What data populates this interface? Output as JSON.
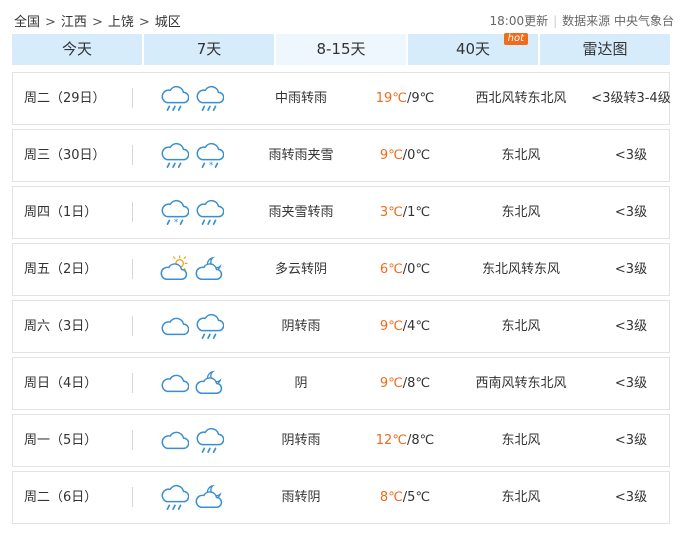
{
  "breadcrumb": [
    "全国",
    "江西",
    "上饶",
    "城区"
  ],
  "breadcrumb_sep": ">",
  "update_time": "18:00更新",
  "data_source": "数据来源 中央气象台",
  "tabs": [
    {
      "label": "今天"
    },
    {
      "label": "7天"
    },
    {
      "label": "8-15天"
    },
    {
      "label": "40天",
      "badge": "hot"
    },
    {
      "label": "雷达图"
    }
  ],
  "active_tab": "8-15天",
  "colors": {
    "high_temp": "#f26a1b",
    "icon_blue": "#3a8fd0",
    "tab_bg": "#d6ecfb"
  },
  "forecast": [
    {
      "date": "周二（29日）",
      "icons": [
        "cloud-rain-icon",
        "cloud-rain-icon"
      ],
      "desc": "中雨转雨",
      "high": "19℃",
      "low": "/9℃",
      "wind": "西北风转东北风",
      "level": "<3级转3-4级"
    },
    {
      "date": "周三（30日）",
      "icons": [
        "cloud-rain-icon",
        "cloud-sleet-icon"
      ],
      "desc": "雨转雨夹雪",
      "high": "9℃",
      "low": "/0℃",
      "wind": "东北风",
      "level": "<3级"
    },
    {
      "date": "周四（1日）",
      "icons": [
        "cloud-sleet-icon",
        "cloud-rain-icon"
      ],
      "desc": "雨夹雪转雨",
      "high": "3℃",
      "low": "/1℃",
      "wind": "东北风",
      "level": "<3级"
    },
    {
      "date": "周五（2日）",
      "icons": [
        "partly-cloudy-sun-icon",
        "partly-cloudy-moon-icon"
      ],
      "desc": "多云转阴",
      "high": "6℃",
      "low": "/0℃",
      "wind": "东北风转东风",
      "level": "<3级"
    },
    {
      "date": "周六（3日）",
      "icons": [
        "cloud-icon",
        "cloud-rain-icon"
      ],
      "desc": "阴转雨",
      "high": "9℃",
      "low": "/4℃",
      "wind": "东北风",
      "level": "<3级"
    },
    {
      "date": "周日（4日）",
      "icons": [
        "cloud-icon",
        "partly-cloudy-moon-icon"
      ],
      "desc": "阴",
      "high": "9℃",
      "low": "/8℃",
      "wind": "西南风转东北风",
      "level": "<3级"
    },
    {
      "date": "周一（5日）",
      "icons": [
        "cloud-icon",
        "cloud-rain-icon"
      ],
      "desc": "阴转雨",
      "high": "12℃",
      "low": "/8℃",
      "wind": "东北风",
      "level": "<3级"
    },
    {
      "date": "周二（6日）",
      "icons": [
        "cloud-rain-icon",
        "partly-cloudy-moon-icon"
      ],
      "desc": "雨转阴",
      "high": "8℃",
      "low": "/5℃",
      "wind": "东北风",
      "level": "<3级"
    }
  ]
}
